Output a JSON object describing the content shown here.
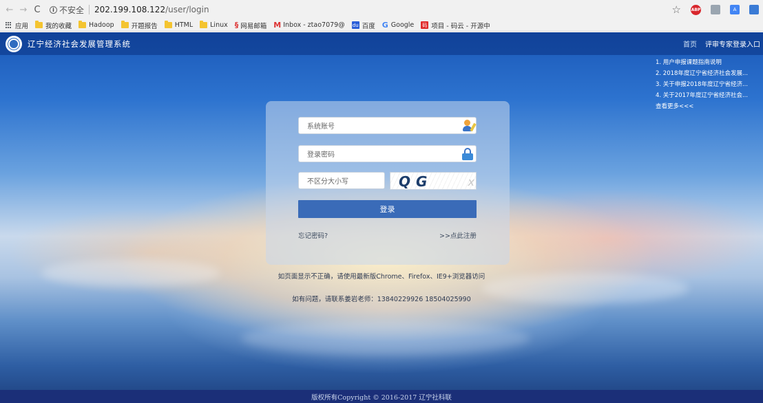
{
  "browser": {
    "security_label": "不安全",
    "url_host": "202.199.108.122",
    "url_path": "/user/login",
    "bookmarks": [
      {
        "label": "应用",
        "icon": "apps-icon"
      },
      {
        "label": "我的收藏",
        "icon": "folder-icon"
      },
      {
        "label": "Hadoop",
        "icon": "folder-icon"
      },
      {
        "label": "开题报告",
        "icon": "folder-icon"
      },
      {
        "label": "HTML",
        "icon": "folder-icon"
      },
      {
        "label": "Linux",
        "icon": "folder-icon"
      },
      {
        "label": "网易邮箱",
        "icon": "netease-mail-icon"
      },
      {
        "label": "Inbox - ztao7079@",
        "icon": "gmail-icon"
      },
      {
        "label": "百度",
        "icon": "baidu-icon"
      },
      {
        "label": "Google",
        "icon": "google-icon"
      },
      {
        "label": "项目 - 码云 - 开源中",
        "icon": "gitee-icon"
      }
    ]
  },
  "header": {
    "site_title": "辽宁经济社会发展管理系统",
    "nav_home": "首页",
    "nav_expert_login": "评审专家登录入口"
  },
  "news": {
    "items": [
      "1. 用户申报课题指南说明",
      "2. 2018年度辽宁省经济社会发展...",
      "3. 关于申报2018年度辽宁省经济...",
      "4. 关于2017年度辽宁省经济社会..."
    ],
    "more": "查看更多<<<"
  },
  "login": {
    "username_placeholder": "系统账号",
    "password_placeholder": "登录密码",
    "captcha_placeholder": "不区分大小写",
    "captcha_text": "QG",
    "captcha_text_faded": "x",
    "submit_label": "登录",
    "forgot_password": "忘记密码?",
    "register": ">>点此注册"
  },
  "notices": {
    "browser": "如页面显示不正确，请使用最新版Chrome、Firefox、IE9+浏览器访问",
    "contact": "如有问题，请联系姜岩老师：13840229926 18504025990"
  },
  "footer": {
    "copyright": "版权所有Copyright © 2016-2017 辽宁社科联"
  }
}
